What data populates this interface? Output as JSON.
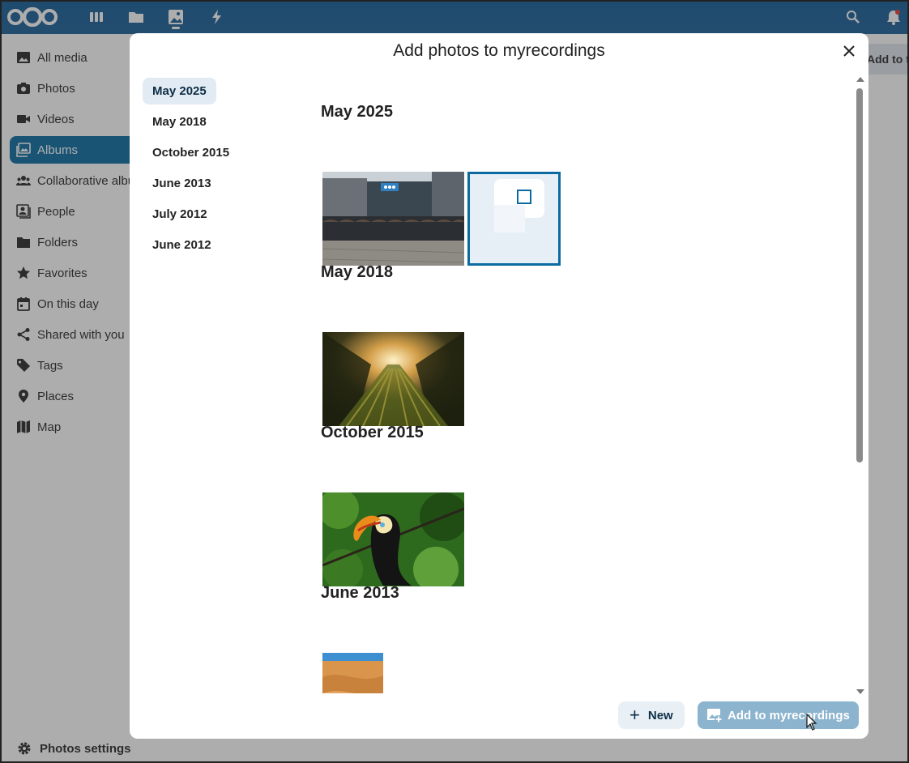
{
  "app": {
    "sidebar": {
      "items": [
        {
          "label": "All media",
          "icon": "image-icon"
        },
        {
          "label": "Photos",
          "icon": "camera-icon"
        },
        {
          "label": "Videos",
          "icon": "video-icon"
        },
        {
          "label": "Albums",
          "icon": "albums-icon",
          "active": true
        },
        {
          "label": "Collaborative albums",
          "icon": "group-icon"
        },
        {
          "label": "People",
          "icon": "people-icon"
        },
        {
          "label": "Folders",
          "icon": "folder-icon"
        },
        {
          "label": "Favorites",
          "icon": "star-icon"
        },
        {
          "label": "On this day",
          "icon": "calendar-icon"
        },
        {
          "label": "Shared with you",
          "icon": "share-icon"
        },
        {
          "label": "Tags",
          "icon": "tag-icon"
        },
        {
          "label": "Places",
          "icon": "map-marker-icon"
        },
        {
          "label": "Map",
          "icon": "map-icon"
        }
      ],
      "settings_label": "Photos settings"
    },
    "content_header_partial": "Add to this album"
  },
  "modal": {
    "title": "Add photos to myrecordings",
    "close_icon": "close-icon",
    "date_nav": [
      {
        "label": "May 2025",
        "active": true
      },
      {
        "label": "May 2018"
      },
      {
        "label": "October 2015"
      },
      {
        "label": "June 2013"
      },
      {
        "label": "July 2012"
      },
      {
        "label": "June 2012"
      }
    ],
    "sections": [
      {
        "title": "May 2025"
      },
      {
        "title": "May 2018"
      },
      {
        "title": "October 2015"
      },
      {
        "title": "June 2013"
      }
    ],
    "buttons": {
      "new_label": "New",
      "add_label": "Add to myrecordings"
    }
  },
  "colors": {
    "accent": "#00679e",
    "nav_active_bg": "#e2ebf3",
    "add_button_disabled": "#8cb4ce",
    "selection_border": "#0b6aa2"
  }
}
